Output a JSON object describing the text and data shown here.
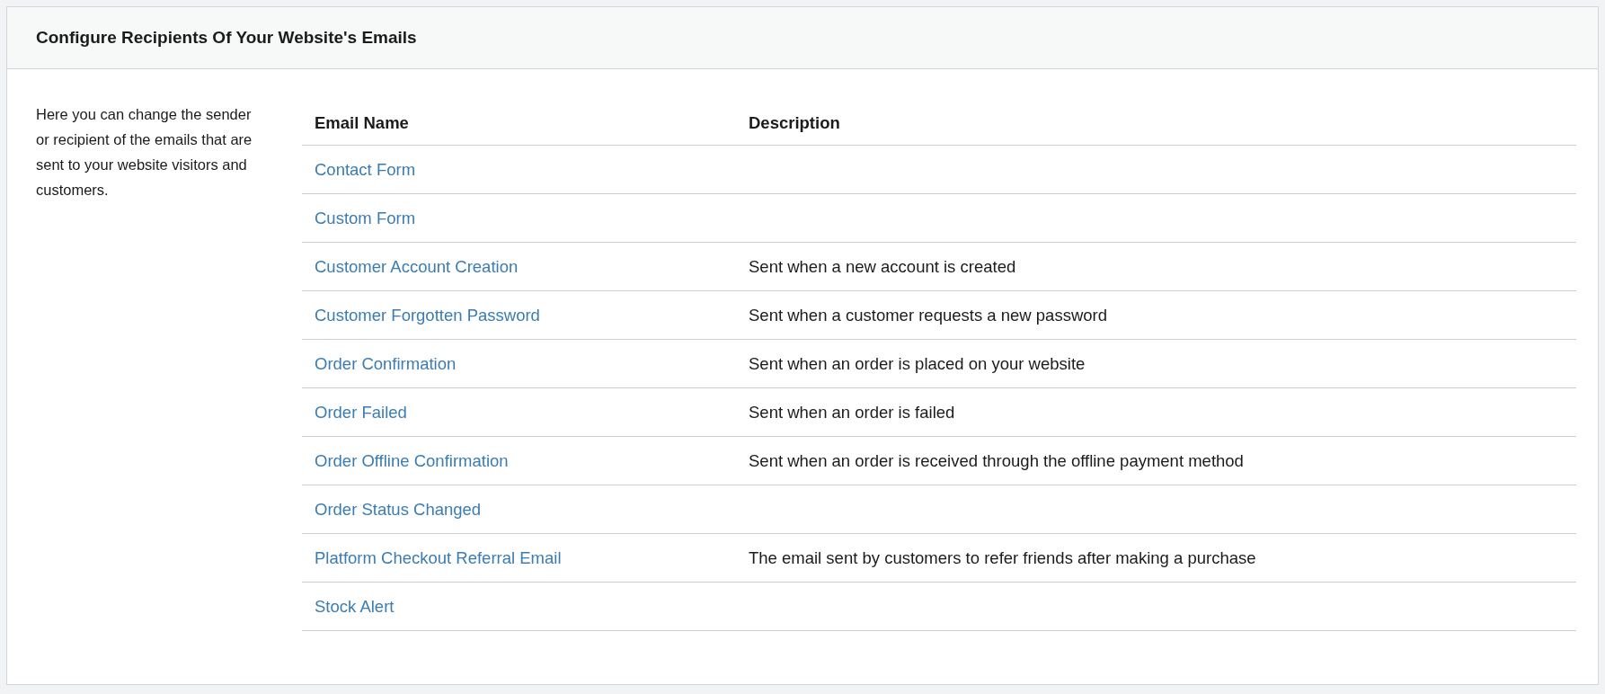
{
  "panel": {
    "title": "Configure Recipients Of Your Website's Emails",
    "intro": "Here you can change the sender or recipient of the emails that are sent to your website visitors and customers."
  },
  "table": {
    "columns": [
      "Email Name",
      "Description"
    ],
    "rows": [
      {
        "name": "Contact Form",
        "description": ""
      },
      {
        "name": "Custom Form",
        "description": ""
      },
      {
        "name": "Customer Account Creation",
        "description": "Sent when a new account is created"
      },
      {
        "name": "Customer Forgotten Password",
        "description": "Sent when a customer requests a new password"
      },
      {
        "name": "Order Confirmation",
        "description": "Sent when an order is placed on your website"
      },
      {
        "name": "Order Failed",
        "description": "Sent when an order is failed"
      },
      {
        "name": "Order Offline Confirmation",
        "description": "Sent when an order is received through the offline payment method"
      },
      {
        "name": "Order Status Changed",
        "description": ""
      },
      {
        "name": "Platform Checkout Referral Email",
        "description": "The email sent by customers to refer friends after making a purchase"
      },
      {
        "name": "Stock Alert",
        "description": ""
      }
    ]
  }
}
